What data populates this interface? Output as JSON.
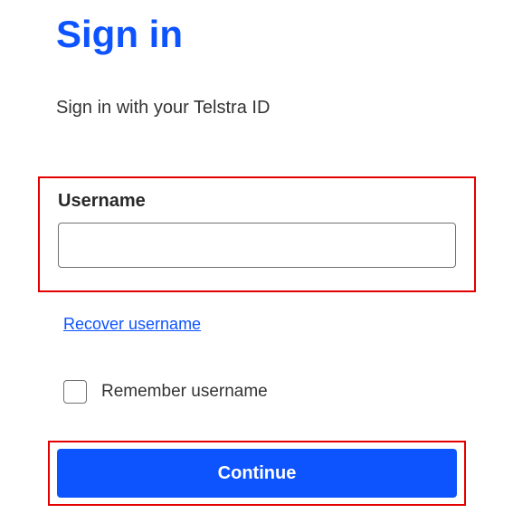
{
  "header": {
    "title": "Sign in",
    "subtitle": "Sign in with your Telstra ID"
  },
  "form": {
    "username_label": "Username",
    "username_value": "",
    "recover_link": "Recover username",
    "remember_label": "Remember username",
    "continue_label": "Continue"
  },
  "colors": {
    "accent": "#0d54ff",
    "highlight_border": "#e40000"
  }
}
